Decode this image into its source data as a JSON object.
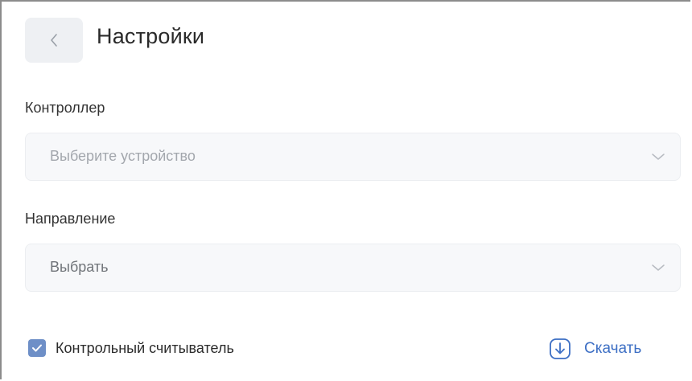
{
  "header": {
    "title": "Настройки",
    "back_icon": "chevron-left-icon"
  },
  "controller": {
    "label": "Контроллер",
    "placeholder": "Выберите устройство"
  },
  "direction": {
    "label": "Направление",
    "value": "Выбрать"
  },
  "control_reader": {
    "label": "Контрольный считыватель",
    "checked": true
  },
  "download": {
    "label": "Скачать",
    "icon": "download-icon"
  },
  "colors": {
    "accent": "#3d6fc4",
    "checkbox": "#6e8fc7",
    "field_bg": "#f7f8fa",
    "back_button_bg": "#eef0f3"
  }
}
